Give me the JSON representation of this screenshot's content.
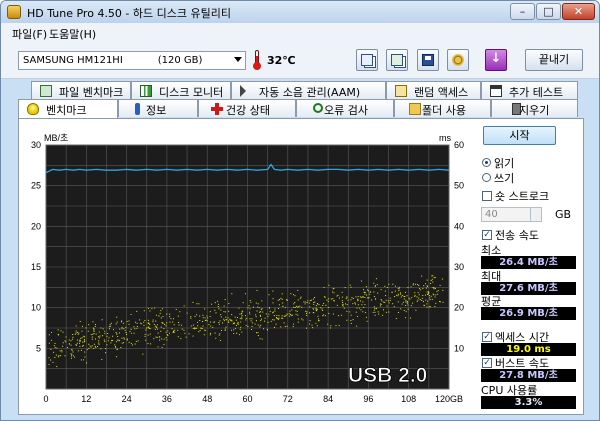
{
  "window": {
    "title": "HD Tune Pro 4.50 - 하드 디스크 유틸리티",
    "controls": {
      "minimize": "–",
      "maximize": "□",
      "close": "✕"
    }
  },
  "menu": [
    {
      "label": "파일(F)"
    },
    {
      "label": "도움말(H)"
    }
  ],
  "toolbar": {
    "drive": "SAMSUNG HM121HI           (120 GB)",
    "temperature": "32℃",
    "exit_label": "끝내기",
    "icons": [
      "copy-icon",
      "copy-all-icon",
      "save-icon",
      "options-icon",
      "download-icon"
    ]
  },
  "tabs_top": [
    {
      "label": "파일 벤치마크",
      "icon": "file-benchmark-icon"
    },
    {
      "label": "디스크 모니터",
      "icon": "disk-monitor-icon"
    },
    {
      "label": "자동 소음 관리(AAM)",
      "icon": "speaker-icon"
    },
    {
      "label": "랜덤 액세스",
      "icon": "random-access-icon"
    },
    {
      "label": "추가 테스트",
      "icon": "extra-tests-icon"
    }
  ],
  "tabs_bottom": [
    {
      "label": "벤치마크",
      "icon": "lightbulb-icon",
      "active": true
    },
    {
      "label": "정보",
      "icon": "info-icon"
    },
    {
      "label": "건강 상태",
      "icon": "health-cross-icon"
    },
    {
      "label": "오류 검사",
      "icon": "magnifier-icon"
    },
    {
      "label": "폴더 사용",
      "icon": "folder-icon"
    },
    {
      "label": "지우기",
      "icon": "trash-icon"
    }
  ],
  "controls": {
    "start_label": "시작",
    "read_label": "읽기",
    "write_label": "쓰기",
    "short_stroke_label": "숏 스트로크",
    "stroke_value": "40",
    "stroke_unit": "GB",
    "transfer_rate_label": "전송 속도",
    "min_label": "최소",
    "min_value": "26.4 MB/초",
    "max_label": "최대",
    "max_value": "27.6 MB/초",
    "avg_label": "평균",
    "avg_value": "26.9 MB/초",
    "access_time_label": "엑세스 시간",
    "access_time_value": "19.0 ms",
    "burst_label": "버스트 속도",
    "burst_value": "27.8 MB/초",
    "cpu_label": "CPU 사용률",
    "cpu_value": "3.3%",
    "read_selected": true,
    "short_stroke_checked": false,
    "transfer_checked": true,
    "access_checked": true,
    "burst_checked": true
  },
  "chart_data": {
    "type": "line",
    "ylabel_left": "MB/초",
    "ylabel_right": "ms",
    "x_ticks": [
      "0",
      "12",
      "24",
      "36",
      "48",
      "60",
      "72",
      "84",
      "96",
      "108",
      "120GB"
    ],
    "y_left_ticks": [
      "5",
      "10",
      "15",
      "20",
      "25",
      "30"
    ],
    "y_right_ticks": [
      "10",
      "20",
      "30",
      "40",
      "50",
      "60"
    ],
    "xlim": [
      0,
      120
    ],
    "ylim_left": [
      0,
      30
    ],
    "ylim_right": [
      0,
      60
    ],
    "watermark": "USB 2.0",
    "background": "#1c1c1c",
    "grid_color": "#5a5a5a",
    "transfer_color": "#2aa8e0",
    "access_color": "#e6e600",
    "series": [
      {
        "kind": "transfer_rate",
        "x": [
          0,
          2,
          4,
          6,
          8,
          10,
          12,
          15,
          18,
          21,
          24,
          27,
          30,
          33,
          36,
          39,
          42,
          45,
          48,
          51,
          54,
          57,
          60,
          63,
          66,
          67,
          68,
          70,
          72,
          75,
          78,
          81,
          84,
          87,
          90,
          93,
          96,
          99,
          102,
          105,
          108,
          111,
          114,
          117,
          120
        ],
        "y": [
          26.6,
          27.0,
          26.9,
          27.0,
          26.9,
          27.0,
          26.9,
          27.0,
          26.9,
          26.9,
          27.0,
          26.9,
          27.0,
          26.9,
          27.0,
          26.9,
          27.0,
          26.9,
          27.0,
          26.9,
          27.0,
          26.9,
          27.0,
          26.9,
          27.0,
          27.6,
          27.0,
          26.9,
          27.0,
          26.9,
          27.0,
          26.9,
          27.0,
          27.0,
          26.9,
          27.0,
          26.9,
          27.0,
          26.9,
          27.0,
          26.9,
          27.0,
          26.9,
          27.0,
          26.9
        ]
      },
      {
        "kind": "access_time_scatter",
        "trend_ms": [
          [
            0,
            10
          ],
          [
            20,
            13
          ],
          [
            40,
            16
          ],
          [
            60,
            18
          ],
          [
            80,
            20
          ],
          [
            100,
            22
          ],
          [
            120,
            24
          ]
        ],
        "spread_ms": 7,
        "count": 900
      }
    ]
  }
}
